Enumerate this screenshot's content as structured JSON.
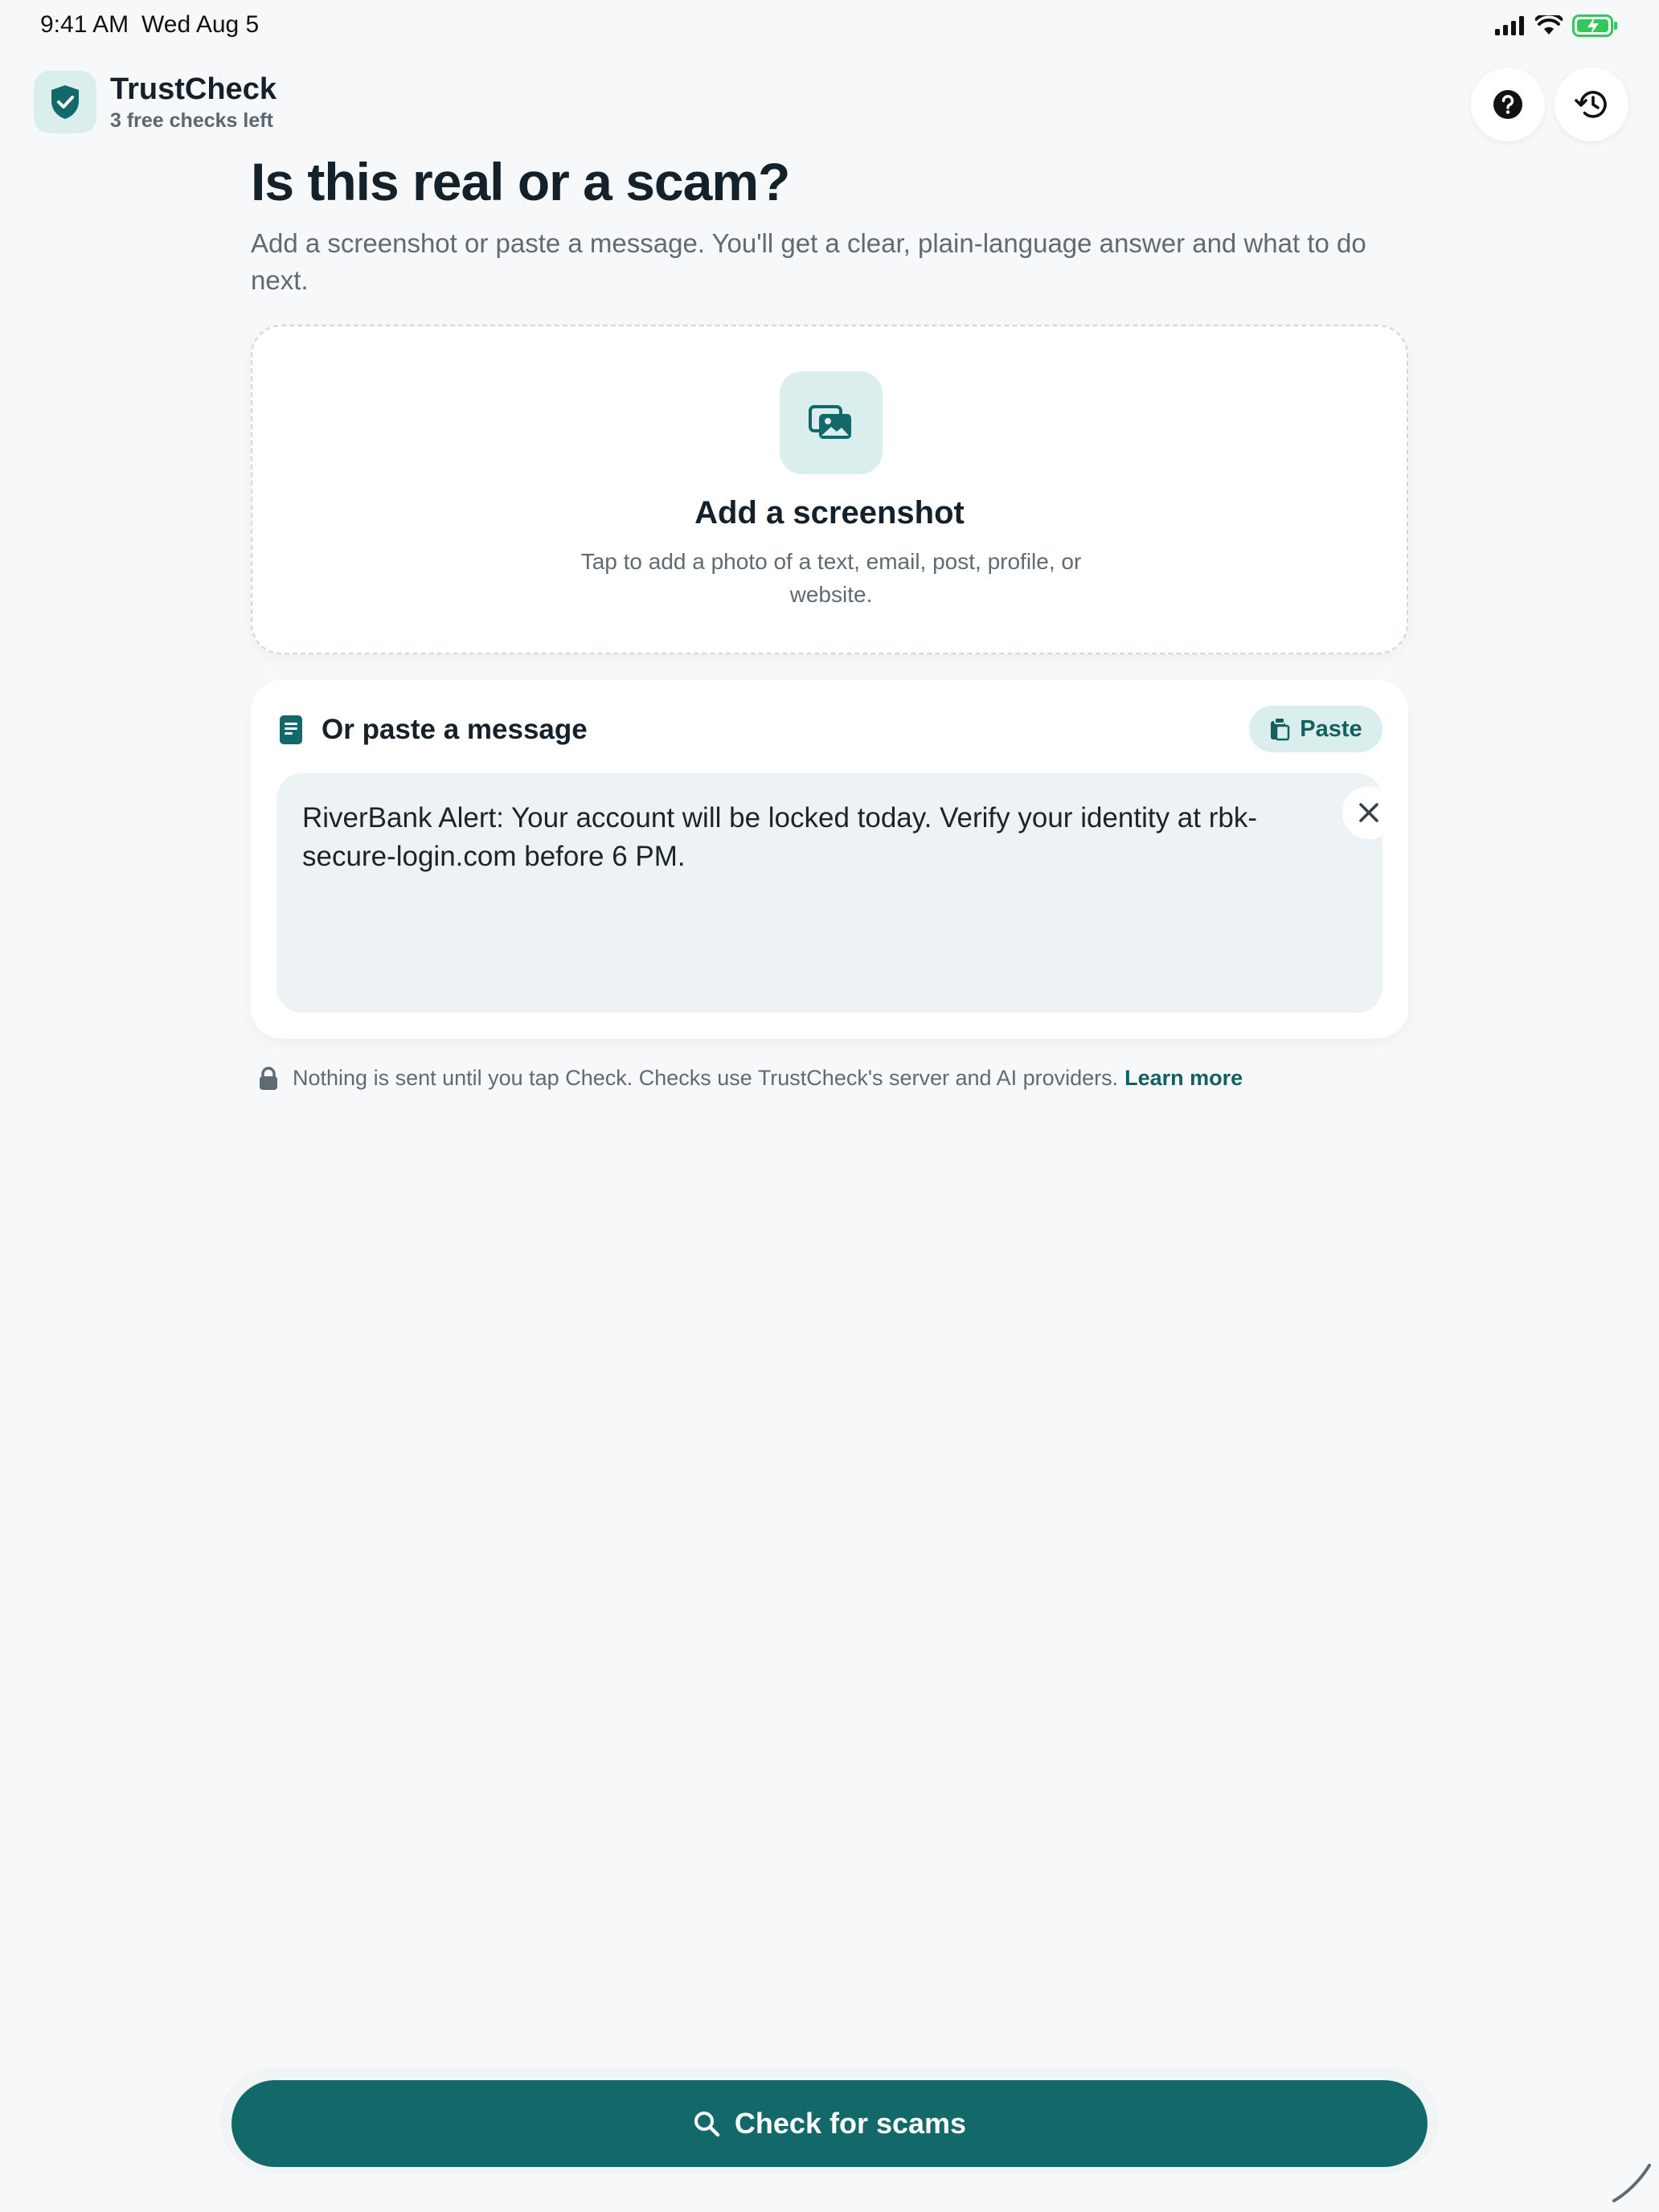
{
  "status_bar": {
    "time": "9:41 AM",
    "date": "Wed Aug 5",
    "icons": [
      "signal-icon",
      "wifi-icon",
      "battery-charging-icon"
    ]
  },
  "header": {
    "app_name": "TrustCheck",
    "checks_left": "3 free checks left",
    "logo_icon": "shield-check-icon",
    "help_icon": "help-icon",
    "history_icon": "history-icon"
  },
  "main": {
    "title": "Is this real or a scam?",
    "subtitle": "Add a screenshot or paste a message. You'll get a clear, plain-language answer and what to do next."
  },
  "screenshot_card": {
    "icon": "photos-icon",
    "title": "Add a screenshot",
    "description": "Tap to add a photo of a text, email, post, profile, or website."
  },
  "paste_card": {
    "icon": "document-icon",
    "title": "Or paste a message",
    "paste_button_label": "Paste",
    "paste_button_icon": "clipboard-icon",
    "message": "RiverBank Alert: Your account will be locked today. Verify your identity at rbk-secure-login.com before 6 PM.",
    "clear_icon": "close-icon"
  },
  "privacy": {
    "icon": "lock-icon",
    "text": "Nothing is sent until you tap Check. Checks use TrustCheck's server and AI providers.",
    "link": "Learn more"
  },
  "cta": {
    "label": "Check for scams",
    "icon": "search-icon"
  },
  "colors": {
    "primary": "#13696A",
    "primary_light": "#D9EEED",
    "background": "#F6F8F9",
    "text": "#14202A",
    "muted": "#5F6B73"
  }
}
